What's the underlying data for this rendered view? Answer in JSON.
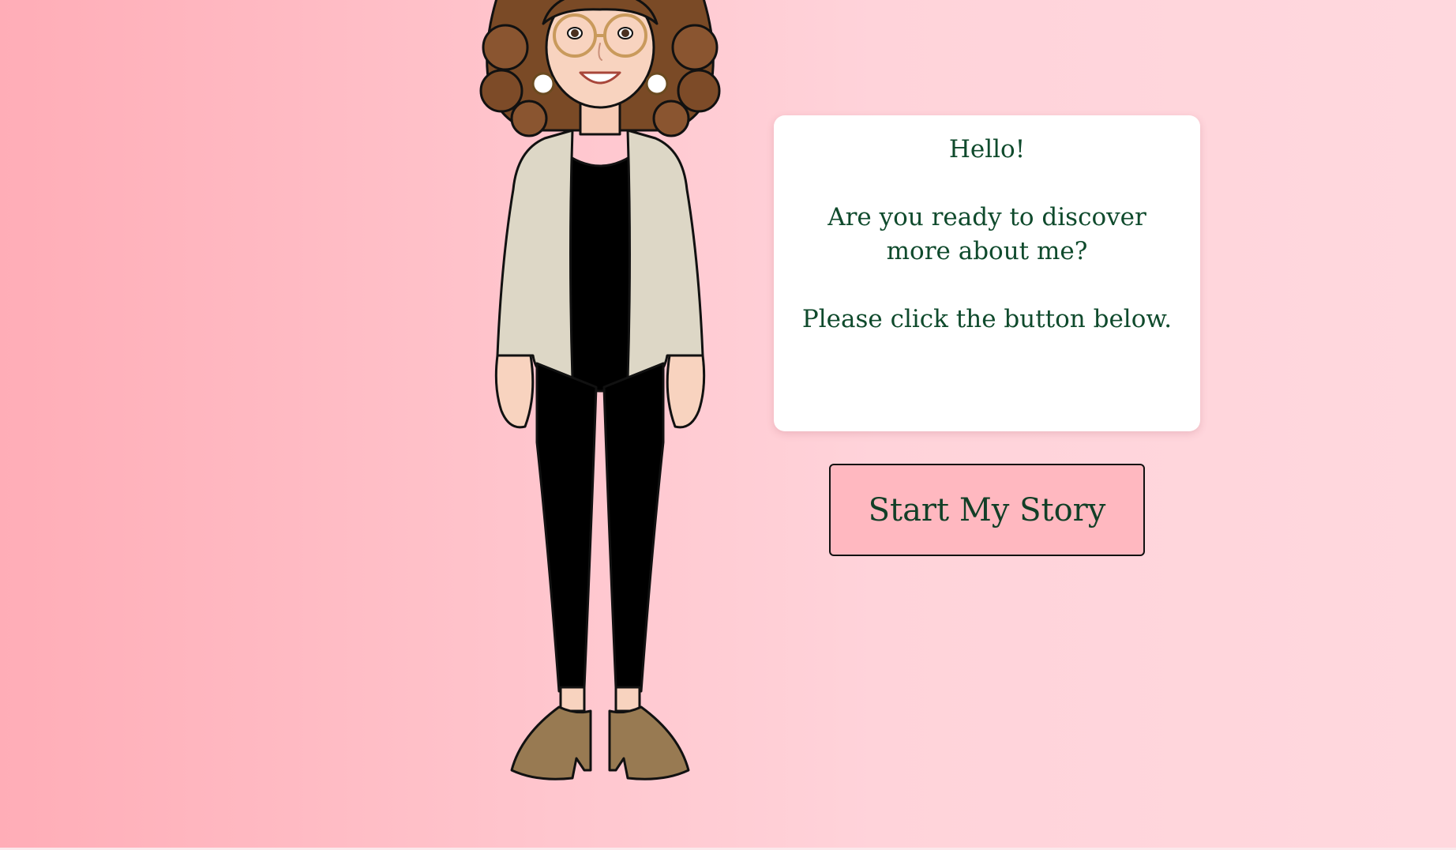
{
  "message": {
    "greeting": "Hello!",
    "question": "Are you ready to discover more about me?",
    "instruction": "Please click the button below."
  },
  "start_button": {
    "label": "Start My Story"
  },
  "colors": {
    "text": "#0f4a2c",
    "button_bg": "#ffb8c0",
    "card_bg": "#ffffff",
    "page_bg_left": "#ffadb7",
    "page_bg_right": "#ffd8de"
  },
  "icons": {
    "character": "avatar-woman-illustration"
  }
}
